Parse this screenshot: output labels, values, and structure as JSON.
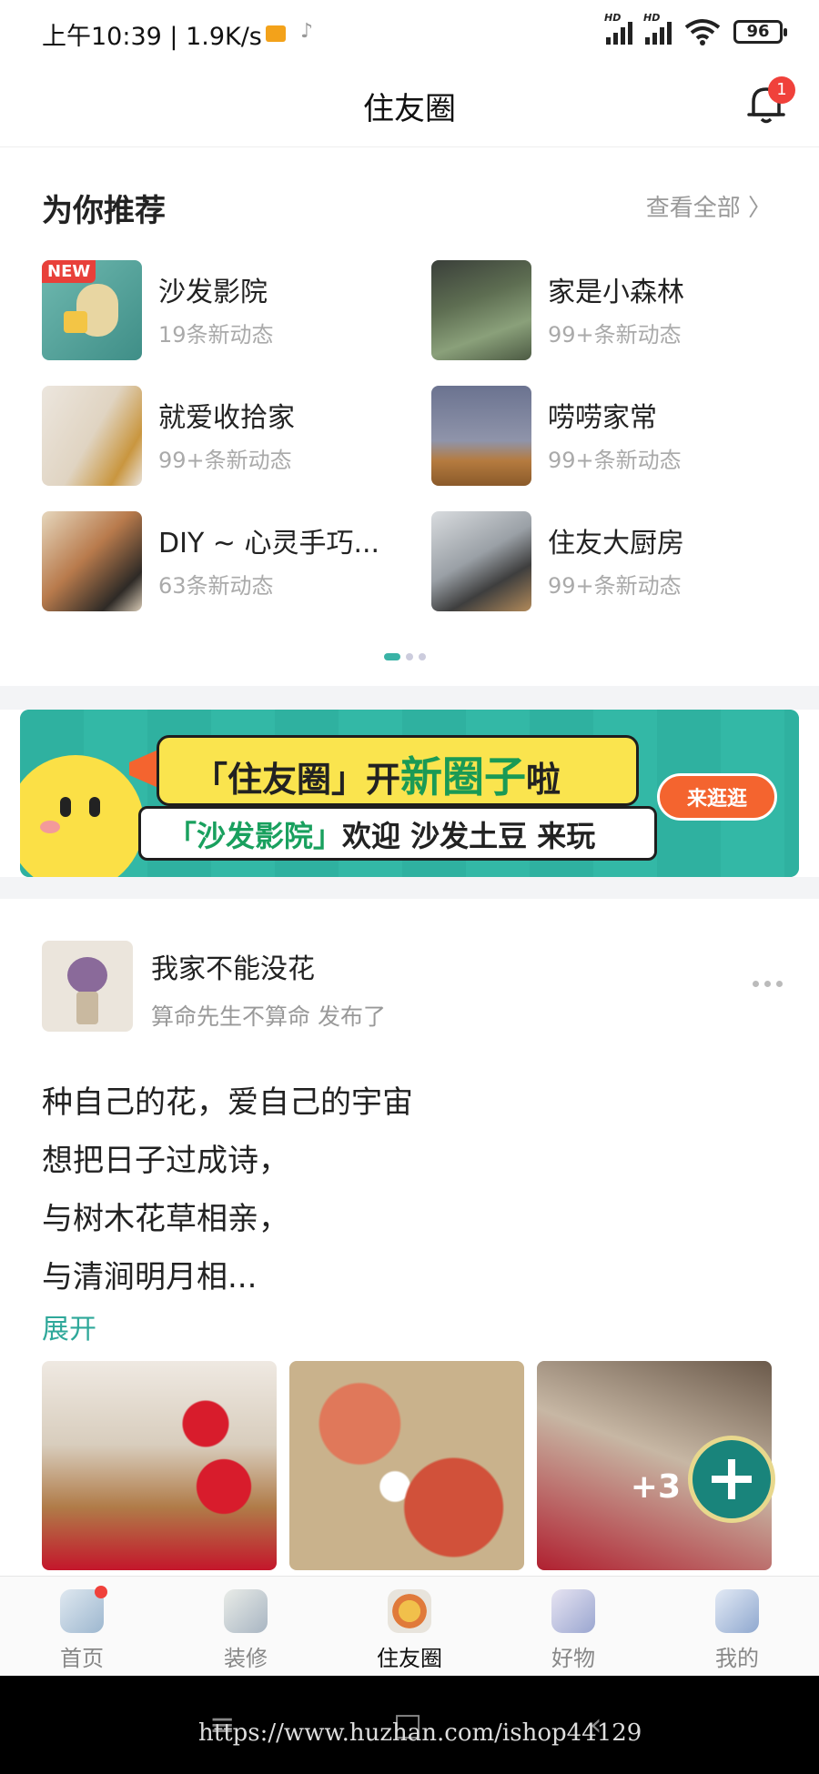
{
  "status_bar": {
    "time_speed": "上午10:39 | 1.9K/s",
    "signal_label": "HD",
    "battery": "96"
  },
  "header": {
    "title": "住友圈",
    "notification_count": "1"
  },
  "recommend": {
    "title": "为你推荐",
    "view_all": "查看全部",
    "new_tag": "NEW",
    "items": [
      {
        "name": "沙发影院",
        "sub": "19条新动态"
      },
      {
        "name": "家是小森林",
        "sub": "99+条新动态"
      },
      {
        "name": "就爱收拾家",
        "sub": "99+条新动态"
      },
      {
        "name": "唠唠家常",
        "sub": "99+条新动态"
      },
      {
        "name": "DIY ~ 心灵手巧...",
        "sub": "63条新动态"
      },
      {
        "name": "住友大厨房",
        "sub": "99+条新动态"
      }
    ]
  },
  "banner": {
    "line1_a": "「住友圈」开",
    "line1_b": "新圈子",
    "line1_c": "啦",
    "line2_a": "「沙发影院」",
    "line2_b": "欢迎 沙发土豆 来玩",
    "button": "来逛逛"
  },
  "post": {
    "circle": "我家不能没花",
    "author": "算命先生不算命 发布了",
    "lines": [
      "种自己的花，爱自己的宇宙",
      "想把日子过成诗，",
      "与树木花草相亲，",
      "与清涧明月相..."
    ],
    "expand": "展开",
    "more_photos": "+3"
  },
  "tabbar": {
    "items": [
      {
        "label": "首页"
      },
      {
        "label": "装修"
      },
      {
        "label": "住友圈"
      },
      {
        "label": "好物"
      },
      {
        "label": "我的"
      }
    ]
  },
  "watermark": "https://www.huzhan.com/ishop44129",
  "colors": {
    "accent": "#2fa89a",
    "badge": "#f0413b",
    "banner_bg": "#2fb1a0"
  }
}
